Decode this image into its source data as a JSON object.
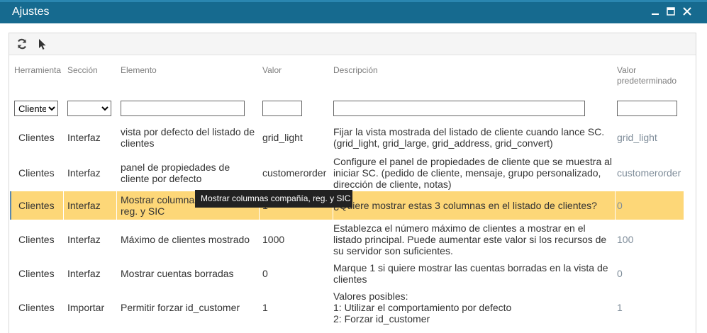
{
  "window": {
    "title": "Ajustes",
    "controls": [
      "minimize-icon",
      "maximize-icon",
      "close-icon"
    ]
  },
  "toolbar": {
    "icons": [
      "refresh-icon",
      "cursor-select-icon"
    ]
  },
  "columns": {
    "herramienta": "Herramienta",
    "seccion": "Sección",
    "elemento": "Elemento",
    "valor": "Valor",
    "descripcion": "Descripción",
    "predeterminado_1": "Valor",
    "predeterminado_2": "predeterminado"
  },
  "filters": {
    "herramienta_selected": "Clientes",
    "seccion_selected": "",
    "elemento": "",
    "valor": "",
    "descripcion": "",
    "predeterminado": ""
  },
  "rows": [
    {
      "herramienta": "Clientes",
      "seccion": "Interfaz",
      "elemento": "vista por defecto del listado de clientes",
      "valor": "grid_light",
      "descripcion": "Fijar la vista mostrada del listado de cliente cuando lance SC. (grid_light, grid_large, grid_address, grid_convert)",
      "predeterminado": "grid_light"
    },
    {
      "herramienta": "Clientes",
      "seccion": "Interfaz",
      "elemento": "panel de propiedades de cliente por defecto",
      "valor": "customerorder",
      "descripcion": "Configure el panel de propiedades de cliente que se muestra al iniciar SC. (pedido de cliente, mensaje, grupo personalizado, dirección de cliente, notas)",
      "predeterminado": "customerorder"
    },
    {
      "herramienta": "Clientes",
      "seccion": "Interfaz",
      "elemento": "Mostrar columnas compañía, reg. y SIC",
      "valor": "1",
      "descripcion": "¿Quiere mostrar estas 3 columnas en el listado de clientes?",
      "predeterminado": "0"
    },
    {
      "herramienta": "Clientes",
      "seccion": "Interfaz",
      "elemento": "Máximo de clientes mostrado",
      "valor": "1000",
      "descripcion": "Establezca el número máximo de clientes a mostrar en el listado principal. Puede aumentar este valor si los recursos de su servidor son suficientes.",
      "predeterminado": "100"
    },
    {
      "herramienta": "Clientes",
      "seccion": "Interfaz",
      "elemento": "Mostrar cuentas borradas",
      "valor": "0",
      "descripcion": "Marque 1 si quiere mostrar las cuentas borradas en la vista de clientes",
      "predeterminado": "0"
    },
    {
      "herramienta": "Clientes",
      "seccion": "Importar",
      "elemento": "Permitir forzar id_customer",
      "valor": "1",
      "descripcion_lines": [
        "Valores posibles:",
        "1: Utilizar el comportamiento por defecto",
        "2: Forzar id_customer"
      ],
      "predeterminado": "1"
    }
  ],
  "tooltip": "Mostrar columnas compañía, reg. y SIC",
  "colors": {
    "titlebar": "#166a8f",
    "selected_row": "#fdd778",
    "default_value_text": "#7e8c99"
  }
}
